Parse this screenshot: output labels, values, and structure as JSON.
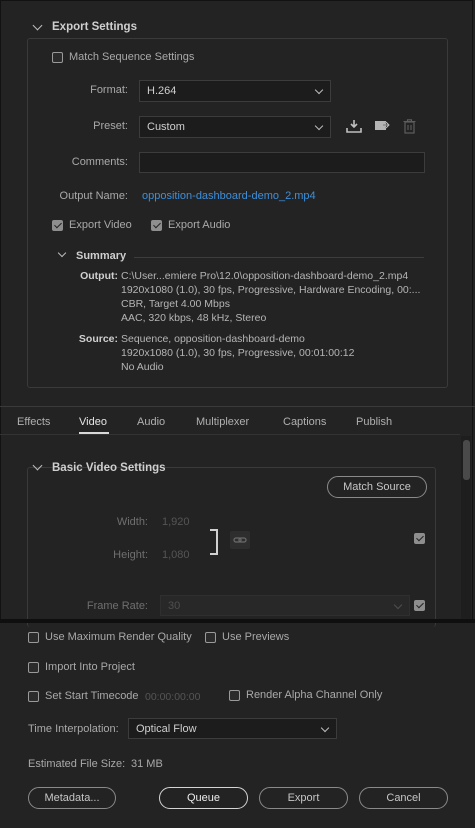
{
  "export_settings": {
    "header": "Export Settings",
    "match_sequence": "Match Sequence Settings",
    "format_label": "Format:",
    "format_value": "H.264",
    "preset_label": "Preset:",
    "preset_value": "Custom",
    "comments_label": "Comments:",
    "comments_value": "",
    "output_name_label": "Output Name:",
    "output_name_value": "opposition-dashboard-demo_2.mp4",
    "export_video": "Export Video",
    "export_audio": "Export Audio",
    "export_video_checked": true,
    "export_audio_checked": true,
    "match_sequence_checked": false
  },
  "summary": {
    "header": "Summary",
    "output_label": "Output:",
    "output_lines": [
      "C:\\User...emiere Pro\\12.0\\opposition-dashboard-demo_2.mp4",
      "1920x1080 (1.0), 30 fps, Progressive, Hardware Encoding, 00:...",
      "CBR, Target 4.00 Mbps",
      "AAC, 320 kbps, 48 kHz, Stereo"
    ],
    "source_label": "Source:",
    "source_lines": [
      "Sequence, opposition-dashboard-demo",
      "1920x1080 (1.0), 30 fps, Progressive, 00:01:00:12",
      "No Audio"
    ]
  },
  "tabs": [
    "Effects",
    "Video",
    "Audio",
    "Multiplexer",
    "Captions",
    "Publish"
  ],
  "active_tab": "Video",
  "basic_video": {
    "header": "Basic Video Settings",
    "match_source": "Match Source",
    "width_label": "Width:",
    "width_value": "1,920",
    "height_label": "Height:",
    "height_value": "1,080",
    "frame_rate_label": "Frame Rate:",
    "frame_rate_value": "30"
  },
  "bottom": {
    "max_render": "Use Maximum Render Quality",
    "use_previews": "Use Previews",
    "import_project": "Import Into Project",
    "set_start_tc": "Set Start Timecode",
    "start_tc_value": "00:00:00:00",
    "render_alpha": "Render Alpha Channel Only",
    "time_interp_label": "Time Interpolation:",
    "time_interp_value": "Optical Flow",
    "est_size_label": "Estimated File Size:",
    "est_size_value": "31 MB"
  },
  "buttons": {
    "metadata": "Metadata...",
    "queue": "Queue",
    "export": "Export",
    "cancel": "Cancel"
  },
  "colors": {
    "background": "#232323",
    "link": "#3d8fdb",
    "panel_border": "#3a3a3a"
  }
}
